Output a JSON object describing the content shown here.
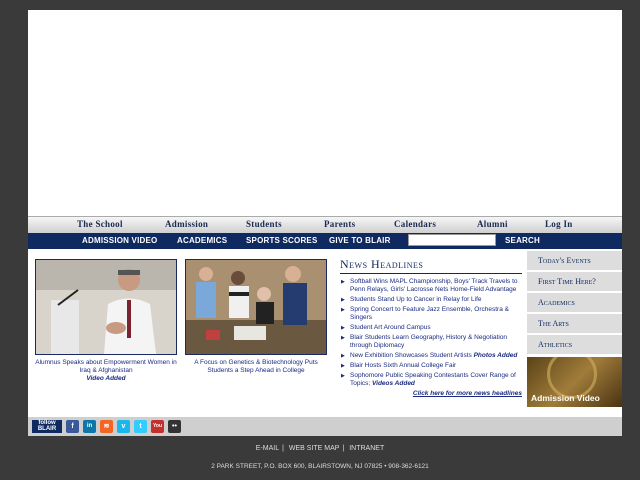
{
  "main_nav": [
    "The School",
    "Admission",
    "Students",
    "Parents",
    "Calendars",
    "Alumni",
    "Log In"
  ],
  "sub_nav": [
    "ADMISSION VIDEO",
    "ACADEMICS",
    "SPORTS SCORES",
    "GIVE TO BLAIR"
  ],
  "search": {
    "placeholder": "",
    "button": "SEARCH"
  },
  "stories": [
    {
      "caption": "Alumnus Speaks about Empowerment Women in Iraq & Afghanistan",
      "tag": "Video Added"
    },
    {
      "caption": "A Focus on Genetics & Biotechnology Puts Students a Step Ahead in College",
      "tag": ""
    }
  ],
  "news": {
    "title": "News Headlines",
    "items": [
      {
        "text": "Softball Wins MAPL Championship, Boys' Track Travels to Penn Relays, Girls' Lacrosse Nets Home-Field Advantage",
        "tag": ""
      },
      {
        "text": "Students Stand Up to Cancer in Relay for Life",
        "tag": ""
      },
      {
        "text": "Spring Concert to Feature Jazz Ensemble, Orchestra & Singers",
        "tag": ""
      },
      {
        "text": "Student Art Around Campus",
        "tag": ""
      },
      {
        "text": "Blair Students Learn Geography, History & Negotiation through Diplomacy",
        "tag": ""
      },
      {
        "text": "New Exhibition Showcases Student Artists",
        "tag": "Photos Added"
      },
      {
        "text": "Blair Hosts Sixth Annual College Fair",
        "tag": ""
      },
      {
        "text": "Sophomore Public Speaking Contestants Cover Range of Topics;",
        "tag": "Videos Added"
      }
    ],
    "more": "Click here for more news headlines"
  },
  "side": [
    "Today's Events",
    "First Time Here?",
    "Academics",
    "The Arts",
    "Athletics"
  ],
  "admission_video": "Admission Video",
  "social": {
    "follow": [
      "follow",
      "BLAIR"
    ],
    "icons": [
      {
        "name": "facebook-icon",
        "glyph": "f",
        "color": "#3b5998"
      },
      {
        "name": "linkedin-icon",
        "glyph": "in",
        "color": "#0e76a8"
      },
      {
        "name": "rss-icon",
        "glyph": "≋",
        "color": "#f26522"
      },
      {
        "name": "vimeo-icon",
        "glyph": "v",
        "color": "#1ab7ea"
      },
      {
        "name": "twitter-icon",
        "glyph": "t",
        "color": "#33ccff"
      },
      {
        "name": "youtube-icon",
        "glyph": "You",
        "color": "#c4302b"
      },
      {
        "name": "flickr-icon",
        "glyph": "••",
        "color": "#333333"
      }
    ]
  },
  "footer": {
    "links": [
      "E-MAIL",
      "WEB SITE MAP",
      "INTRANET"
    ],
    "address": "2 PARK STREET, P.O. BOX 600, BLAIRSTOWN, NJ 07825  •  908-362-6121"
  }
}
